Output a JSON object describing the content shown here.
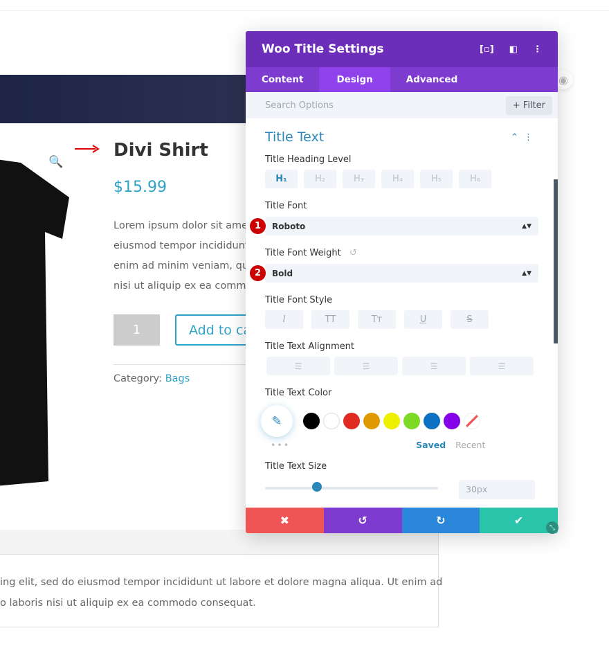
{
  "product": {
    "title": "Divi Shirt",
    "price": "$15.99",
    "description": [
      "Lorem ipsum dolor sit amet,",
      "eiusmod tempor incididunt",
      "enim ad minim veniam, quis",
      "nisi ut aliquip ex ea commodo"
    ],
    "quantity": "1",
    "add_to_cart": "Add to cart",
    "category_label": "Category: ",
    "category_link": "Bags",
    "tab_text": [
      "ing elit, sed do eiusmod tempor incididunt ut labore et dolore magna aliqua. Ut enim ad",
      "o laboris nisi ut aliquip ex ea commodo consequat."
    ]
  },
  "panel": {
    "title": "Woo Title Settings",
    "tabs": [
      "Content",
      "Design",
      "Advanced"
    ],
    "active_tab": "Design",
    "search_placeholder": "Search Options",
    "filter_label": "+ Filter",
    "section_title": "Title Text",
    "heading_level": {
      "label": "Title Heading Level",
      "options": [
        "H₁",
        "H₂",
        "H₃",
        "H₄",
        "H₅",
        "H₆"
      ],
      "selected": "H₁"
    },
    "font": {
      "label": "Title Font",
      "value": "Roboto",
      "badge": "1"
    },
    "font_weight": {
      "label": "Title Font Weight",
      "value": "Bold",
      "badge": "2"
    },
    "font_style": {
      "label": "Title Font Style",
      "options": [
        "I",
        "TT",
        "Tт",
        "U",
        "S"
      ]
    },
    "alignment": {
      "label": "Title Text Alignment"
    },
    "color": {
      "label": "Title Text Color",
      "swatches": [
        "#000000",
        "#ffffff",
        "#e02b20",
        "#e09900",
        "#edf000",
        "#7cda24",
        "#0c71c3",
        "#8300e9"
      ],
      "saved": "Saved",
      "recent": "Recent"
    },
    "size": {
      "label": "Title Text Size",
      "value": "30px",
      "slider_fraction": 0.3
    }
  },
  "colors": {
    "header": "#6c2eb9",
    "tabs": "#7e3bd0",
    "active_tab": "#8f42ec",
    "cancel": "#ef5555",
    "undo": "#7e3bd0",
    "redo": "#2b87da",
    "save": "#29c4a9",
    "accent": "#2ea3c6"
  }
}
